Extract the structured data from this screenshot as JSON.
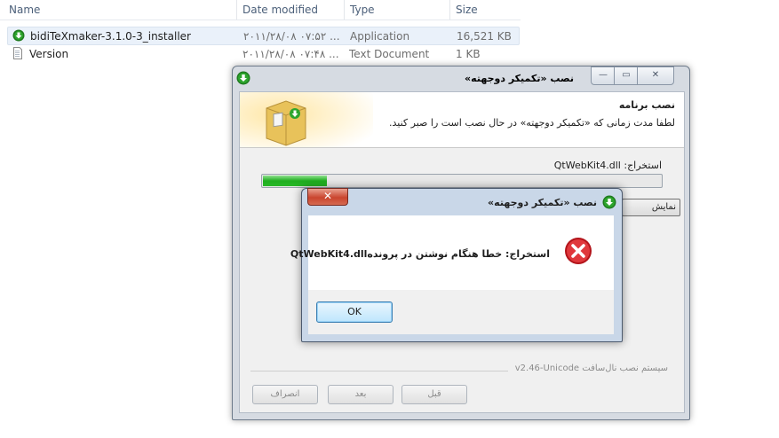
{
  "explorer": {
    "columns": [
      "Name",
      "Date modified",
      "Type",
      "Size"
    ],
    "rows": [
      {
        "name": "bidiTeXmaker-3.1.0-3_installer",
        "date": "۲۰۱۱/۲۸/۰۸ ۰۷:۵۲ ...",
        "type": "Application",
        "size": "16,521 KB",
        "icon": "installer-icon"
      },
      {
        "name": "Version",
        "date": "۲۰۱۱/۲۸/۰۸ ۰۷:۴۸ ...",
        "type": "Text Document",
        "size": "1 KB",
        "icon": "text-file-icon"
      }
    ]
  },
  "installer": {
    "title": "نصب «تکمیکر دوجهته»",
    "banner_heading": "نصب برنامه",
    "banner_sub": "لطفا مدت زمانی که «تکمیکر دوجهته» در حال نصب است را صبر کنید.",
    "extract_text": "استخراج: QtWebKit4.dll",
    "progress": 0.16,
    "show_details": "نمایش جزئیات",
    "branding": "سیستم نصب نال‌سافت v2.46-Unicode",
    "buttons": {
      "back": "قبل",
      "next": "بعد",
      "cancel": "انصراف"
    }
  },
  "error_dialog": {
    "title": "نصب «تکمیکر دوجهته»",
    "message": "استخراج: خطا هنگام نوشتن در پروندهQtWebKit4.dll",
    "ok": "OK",
    "close": "✕"
  },
  "colors": {
    "progress": "#1fae1f",
    "error": "#d2252a"
  }
}
